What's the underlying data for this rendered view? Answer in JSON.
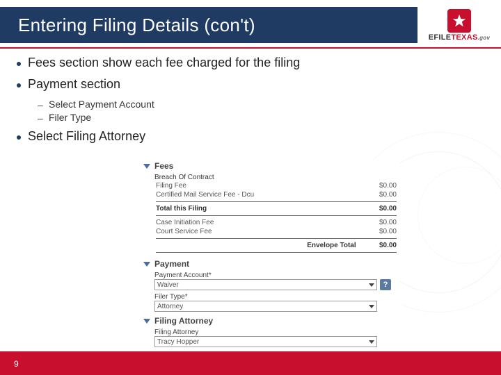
{
  "title": "Entering Filing Details (con't)",
  "logo": {
    "brand_pre": "EFILE",
    "brand_accent": "TEXAS",
    "suffix": ".gov"
  },
  "bullets": {
    "b1": "Fees section show each fee charged for the filing",
    "b2": "Payment section",
    "b2_sub": [
      "Select Payment Account",
      "Filer Type"
    ],
    "b3": "Select Filing Attorney"
  },
  "page_number": "9",
  "shot": {
    "fees": {
      "header": "Fees",
      "case_type": "Breach Of Contract",
      "rows": [
        {
          "label": "Filing Fee",
          "amt": "$0.00"
        },
        {
          "label": "Certified Mail Service Fee - Dcu",
          "amt": "$0.00"
        }
      ],
      "total_filing": {
        "label": "Total this Filing",
        "amt": "$0.00"
      },
      "extra_rows": [
        {
          "label": "Case Initiation Fee",
          "amt": "$0.00"
        },
        {
          "label": "Court Service Fee",
          "amt": "$0.00"
        }
      ],
      "envelope": {
        "label": "Envelope Total",
        "amt": "$0.00"
      }
    },
    "payment": {
      "header": "Payment",
      "acct_label": "Payment Account*",
      "acct_value": "Waiver",
      "filer_label": "Filer Type*",
      "filer_value": "Attorney",
      "help": "?"
    },
    "attorney": {
      "header": "Filing Attorney",
      "label": "Filing Attorney",
      "value": "Tracy Hopper"
    }
  }
}
